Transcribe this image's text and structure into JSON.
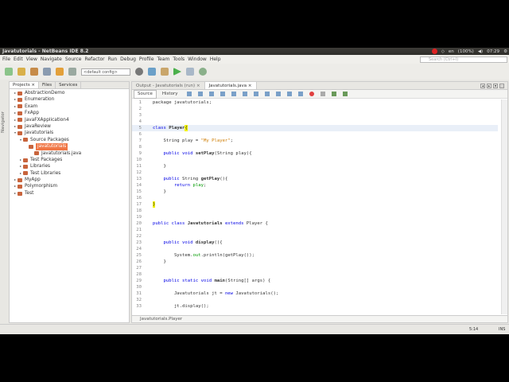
{
  "window": {
    "title": "Javatutorials - NetBeans IDE 8.2"
  },
  "tray": {
    "lang": "en",
    "battery": "(100%)",
    "time": "07:29"
  },
  "search": {
    "placeholder": "Search (Ctrl+I)"
  },
  "menu": [
    "File",
    "Edit",
    "View",
    "Navigate",
    "Source",
    "Refactor",
    "Run",
    "Debug",
    "Profile",
    "Team",
    "Tools",
    "Window",
    "Help"
  ],
  "toolbar": {
    "config": "<default config>"
  },
  "navigator": {
    "label": "Navigator"
  },
  "project_tabs": [
    "Projects",
    "Files",
    "Services"
  ],
  "tree": [
    {
      "label": "AbstractionDemo",
      "level": 0,
      "arrow": "▸"
    },
    {
      "label": "Enumeration",
      "level": 0,
      "arrow": "▸"
    },
    {
      "label": "Exam",
      "level": 0,
      "arrow": "▸"
    },
    {
      "label": "FxApp",
      "level": 0,
      "arrow": "▸"
    },
    {
      "label": "JavaFXApplication4",
      "level": 0,
      "arrow": "▸"
    },
    {
      "label": "JavaReview",
      "level": 0,
      "arrow": "▸"
    },
    {
      "label": "Javatutorials",
      "level": 0,
      "arrow": "▾"
    },
    {
      "label": "Source Packages",
      "level": 1,
      "arrow": "▾"
    },
    {
      "label": "javatutorials",
      "level": 2,
      "arrow": "",
      "selected": true
    },
    {
      "label": "Javatutorials.java",
      "level": 3,
      "arrow": ""
    },
    {
      "label": "Test Packages",
      "level": 1,
      "arrow": "▸"
    },
    {
      "label": "Libraries",
      "level": 1,
      "arrow": "▸"
    },
    {
      "label": "Test Libraries",
      "level": 1,
      "arrow": "▸"
    },
    {
      "label": "MyApp",
      "level": 0,
      "arrow": "▸"
    },
    {
      "label": "Polymorphism",
      "level": 0,
      "arrow": "▸"
    },
    {
      "label": "Test",
      "level": 0,
      "arrow": "▸"
    }
  ],
  "editor_tabs": [
    "Output - Javatutorials (run)",
    "Javatutorials.java"
  ],
  "source_tabs": [
    "Source",
    "History"
  ],
  "code": [
    [
      [
        "package javatutorials;",
        ""
      ]
    ],
    [],
    [],
    [],
    [
      [
        "class ",
        "kw"
      ],
      [
        "Player",
        "b"
      ],
      [
        "{",
        "brace"
      ]
    ],
    [],
    [
      [
        "    String play = ",
        ""
      ],
      [
        "\"My Player\"",
        "str"
      ],
      [
        ";",
        ""
      ]
    ],
    [],
    [
      [
        "    public void ",
        "kw"
      ],
      [
        "setPlay",
        "b"
      ],
      [
        "(String play){",
        ""
      ]
    ],
    [],
    [
      [
        "    }",
        ""
      ]
    ],
    [],
    [
      [
        "    public ",
        "kw"
      ],
      [
        "String ",
        ""
      ],
      [
        "getPlay",
        "b"
      ],
      [
        "(){",
        ""
      ]
    ],
    [
      [
        "        return ",
        "kw"
      ],
      [
        "play",
        "fld"
      ],
      [
        ";",
        ""
      ]
    ],
    [
      [
        "    }",
        ""
      ]
    ],
    [],
    [
      [
        "}",
        "brace"
      ]
    ],
    [],
    [],
    [
      [
        "public class ",
        "kw"
      ],
      [
        "Javatutorials ",
        "b"
      ],
      [
        "extends ",
        "kw"
      ],
      [
        "Player {",
        ""
      ]
    ],
    [],
    [],
    [
      [
        "    public void ",
        "kw"
      ],
      [
        "display",
        "b"
      ],
      [
        "(){",
        ""
      ]
    ],
    [],
    [
      [
        "        System.",
        ""
      ],
      [
        "out",
        "fld"
      ],
      [
        ".println(getPlay());",
        ""
      ]
    ],
    [
      [
        "    }",
        ""
      ]
    ],
    [],
    [],
    [
      [
        "    public static void ",
        "kw"
      ],
      [
        "main",
        "b"
      ],
      [
        "(String[] args) {",
        ""
      ]
    ],
    [],
    [
      [
        "        Javatutorials jt = ",
        ""
      ],
      [
        "new ",
        "kw"
      ],
      [
        "Javatutorials();",
        ""
      ]
    ],
    [],
    [
      [
        "        jt.display();",
        ""
      ]
    ]
  ],
  "breadcrumb": "Javatutorials.Player",
  "status": {
    "position": "5:14",
    "mode": "INS"
  }
}
